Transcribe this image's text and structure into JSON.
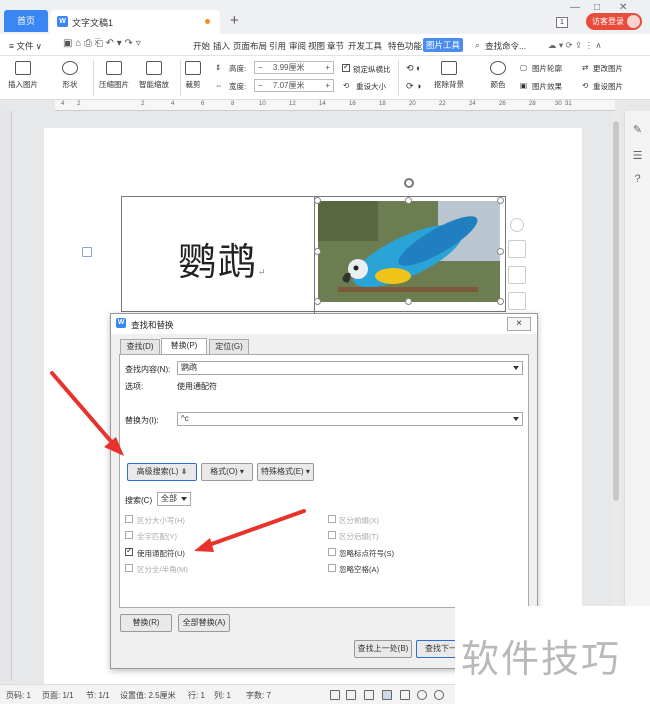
{
  "titlebar": {
    "home_tab": "首页",
    "doc_tab": "文字文稿1",
    "new_tab": "+",
    "page_badge": "1",
    "login": "访客登录"
  },
  "menubar": {
    "file": "≡ 文件 ∨",
    "items": [
      "开始",
      "插入",
      "页面布局",
      "引用",
      "审阅",
      "视图",
      "章节",
      "开发工具",
      "特色功能"
    ],
    "active": "图片工具",
    "search": "查找命令..."
  },
  "ribbon": {
    "insert_pic": "插入图片",
    "shape": "形状",
    "compress": "压缩图片",
    "smart_zoom": "智能缩放",
    "crop": "裁剪",
    "height_label": "高度:",
    "height_value": "3.99厘米",
    "width_label": "宽度:",
    "width_value": "7.07厘米",
    "lock_ratio": "锁定纵横比",
    "reset_size": "重设大小",
    "remove_bg": "抠除背景",
    "color": "颜色",
    "outline": "图片轮廓",
    "effect": "图片效果",
    "change_pic": "更改图片",
    "reset_pic": "重设图片"
  },
  "ruler": {
    "ticks": [
      "4",
      "2",
      "2",
      "4",
      "6",
      "8",
      "10",
      "12",
      "14",
      "16",
      "18",
      "20",
      "22",
      "24",
      "26",
      "28",
      "30",
      "31"
    ]
  },
  "document": {
    "cell_text": "鹦鹉",
    "return_mark": "↵"
  },
  "dialog": {
    "title": "查找和替换",
    "close": "×",
    "tabs": [
      "查找(D)",
      "替换(P)",
      "定位(G)"
    ],
    "find_label": "查找内容(N):",
    "find_value": "鹦鹉",
    "options_label": "选项:",
    "options_value": "使用通配符",
    "replace_label": "替换为(I):",
    "replace_value": "^c",
    "btn_advanced": "高级搜索(L) ⇟",
    "btn_format": "格式(O) ▾",
    "btn_special": "特殊格式(E) ▾",
    "search_label": "搜索(C)",
    "search_value": "全部",
    "options_left": [
      {
        "label": "区分大小写(H)",
        "checked": false,
        "disabled": true
      },
      {
        "label": "全字匹配(Y)",
        "checked": false,
        "disabled": true
      },
      {
        "label": "使用通配符(U)",
        "checked": true,
        "disabled": false
      },
      {
        "label": "区分全/半角(M)",
        "checked": false,
        "disabled": true
      }
    ],
    "options_right": [
      {
        "label": "区分前缀(X)",
        "checked": false,
        "disabled": true
      },
      {
        "label": "区分后缀(T)",
        "checked": false,
        "disabled": true
      },
      {
        "label": "忽略标点符号(S)",
        "checked": false,
        "disabled": false
      },
      {
        "label": "忽略空格(A)",
        "checked": false,
        "disabled": false
      }
    ],
    "btn_replace": "替换(R)",
    "btn_replace_all": "全部替换(A)",
    "btn_find_prev": "查找上一处(B)",
    "btn_find_next": "查找下一处"
  },
  "statusbar": {
    "page_num": "页码: 1",
    "pages": "页面: 1/1",
    "section": "节: 1/1",
    "setting": "设置值: 2.5厘米",
    "row": "行: 1",
    "col": "列: 1",
    "chars": "字数: 7"
  },
  "watermark": "软件技巧",
  "colors": {
    "accent": "#3b86f5",
    "login": "#e84c3d",
    "arrow": "#e8322b"
  }
}
